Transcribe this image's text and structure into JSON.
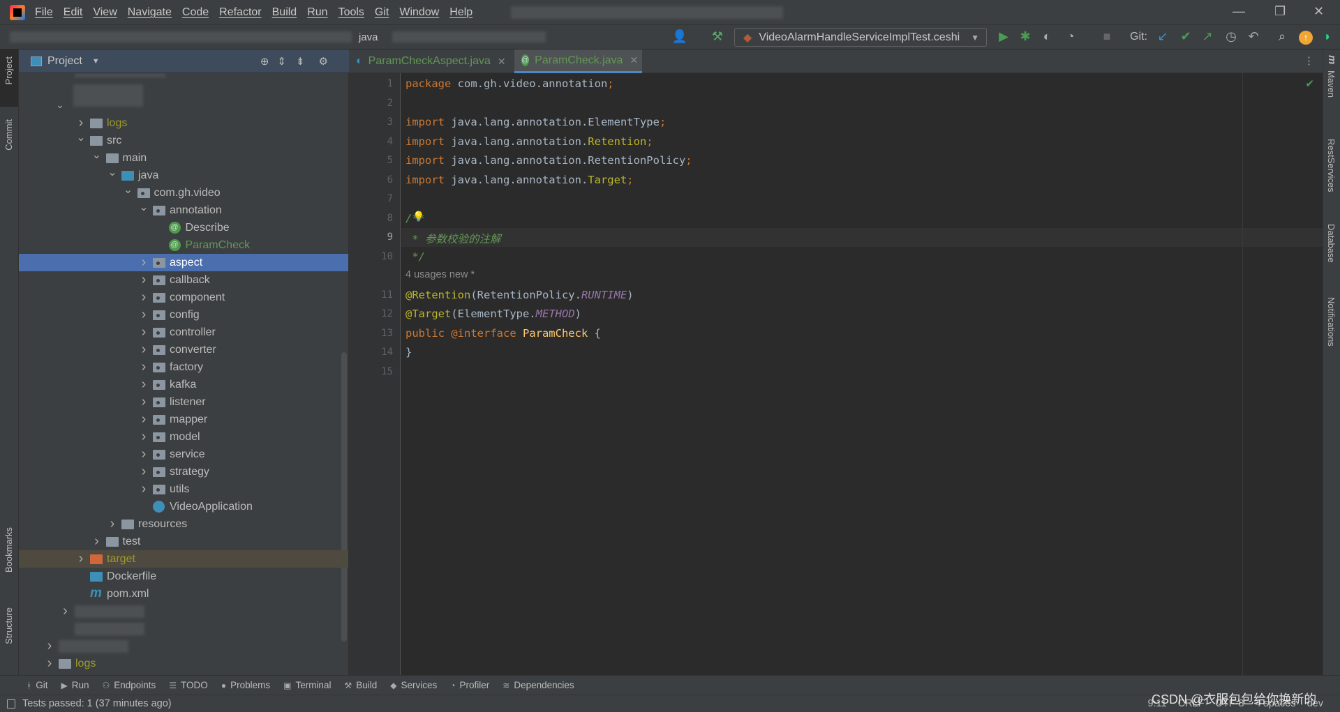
{
  "menu": [
    "File",
    "Edit",
    "View",
    "Navigate",
    "Code",
    "Refactor",
    "Build",
    "Run",
    "Tools",
    "Git",
    "Window",
    "Help"
  ],
  "nav": {
    "crumb_java": "java"
  },
  "toolbar": {
    "run_config": "VideoAlarmHandleServiceImplTest.ceshi",
    "git_label": "Git:"
  },
  "left_stripe": [
    "Project",
    "Commit",
    "Bookmarks",
    "Structure"
  ],
  "right_stripe": [
    "Maven",
    "RestServices",
    "Database",
    "Notifications"
  ],
  "project_panel": {
    "title": "Project"
  },
  "tree": [
    {
      "label": "logs",
      "level": 0,
      "chevron": ">",
      "icon": "folder",
      "color": "#9e9b2b"
    },
    {
      "label": "src",
      "level": 0,
      "chevron": "v",
      "icon": "folder"
    },
    {
      "label": "main",
      "level": 1,
      "chevron": "v",
      "icon": "folder"
    },
    {
      "label": "java",
      "level": 2,
      "chevron": "v",
      "icon": "folder-blue"
    },
    {
      "label": "com.gh.video",
      "level": 3,
      "chevron": "v",
      "icon": "package"
    },
    {
      "label": "annotation",
      "level": 4,
      "chevron": "v",
      "icon": "package"
    },
    {
      "label": "Describe",
      "level": 5,
      "chevron": "",
      "icon": "annotation"
    },
    {
      "label": "ParamCheck",
      "level": 5,
      "chevron": "",
      "icon": "annotation",
      "color": "#629755"
    },
    {
      "label": "aspect",
      "level": 4,
      "chevron": ">",
      "icon": "package",
      "selected": true
    },
    {
      "label": "callback",
      "level": 4,
      "chevron": ">",
      "icon": "package"
    },
    {
      "label": "component",
      "level": 4,
      "chevron": ">",
      "icon": "package"
    },
    {
      "label": "config",
      "level": 4,
      "chevron": ">",
      "icon": "package"
    },
    {
      "label": "controller",
      "level": 4,
      "chevron": ">",
      "icon": "package"
    },
    {
      "label": "converter",
      "level": 4,
      "chevron": ">",
      "icon": "package"
    },
    {
      "label": "factory",
      "level": 4,
      "chevron": ">",
      "icon": "package"
    },
    {
      "label": "kafka",
      "level": 4,
      "chevron": ">",
      "icon": "package"
    },
    {
      "label": "listener",
      "level": 4,
      "chevron": ">",
      "icon": "package"
    },
    {
      "label": "mapper",
      "level": 4,
      "chevron": ">",
      "icon": "package"
    },
    {
      "label": "model",
      "level": 4,
      "chevron": ">",
      "icon": "package"
    },
    {
      "label": "service",
      "level": 4,
      "chevron": ">",
      "icon": "package"
    },
    {
      "label": "strategy",
      "level": 4,
      "chevron": ">",
      "icon": "package"
    },
    {
      "label": "utils",
      "level": 4,
      "chevron": ">",
      "icon": "package"
    },
    {
      "label": "VideoApplication",
      "level": 4,
      "chevron": "",
      "icon": "spring-app"
    },
    {
      "label": "resources",
      "level": 2,
      "chevron": ">",
      "icon": "folder"
    },
    {
      "label": "test",
      "level": 1,
      "chevron": ">",
      "icon": "folder"
    },
    {
      "label": "target",
      "level": 0,
      "chevron": ">",
      "icon": "folder-orange",
      "color": "#9e9b2b",
      "highlight": true
    },
    {
      "label": "Dockerfile",
      "level": 0,
      "chevron": "",
      "icon": "docker"
    },
    {
      "label": "pom.xml",
      "level": 0,
      "chevron": "",
      "icon": "maven"
    },
    {
      "label": "",
      "level": -1,
      "chevron": ">",
      "icon": "blurred"
    },
    {
      "label": "",
      "level": -1,
      "chevron": "",
      "icon": "blurred"
    },
    {
      "label": "",
      "level": -2,
      "chevron": ">",
      "icon": "blurred"
    },
    {
      "label": "logs",
      "level": -2,
      "chevron": ">",
      "icon": "folder",
      "color": "#9e9b2b"
    }
  ],
  "tabs": [
    {
      "label": "ParamCheckAspect.java",
      "icon": "aspect-class-icon",
      "active": false
    },
    {
      "label": "ParamCheck.java",
      "icon": "annotation-icon",
      "active": true
    }
  ],
  "editor": {
    "current_line": 9,
    "inlay": "4 usages   new *",
    "lines": [
      [
        [
          "kw",
          "package "
        ],
        [
          "cls",
          "com.gh.video.annotation"
        ],
        [
          "semi",
          ";"
        ]
      ],
      [],
      [
        [
          "kw",
          "import "
        ],
        [
          "cls",
          "java.lang.annotation.ElementType"
        ],
        [
          "semi",
          ";"
        ]
      ],
      [
        [
          "kw",
          "import "
        ],
        [
          "cls",
          "java.lang.annotation."
        ],
        [
          "ann",
          "Retention"
        ],
        [
          "semi",
          ";"
        ]
      ],
      [
        [
          "kw",
          "import "
        ],
        [
          "cls",
          "java.lang.annotation.RetentionPolicy"
        ],
        [
          "semi",
          ";"
        ]
      ],
      [
        [
          "kw",
          "import "
        ],
        [
          "cls",
          "java.lang.annotation."
        ],
        [
          "ann",
          "Target"
        ],
        [
          "semi",
          ";"
        ]
      ],
      [],
      [
        [
          "cmt",
          "/**"
        ]
      ],
      [
        [
          "cmt",
          " * 参数校验的注解"
        ]
      ],
      [
        [
          "cmt",
          " */"
        ]
      ],
      [
        [
          "ann",
          "@Retention"
        ],
        [
          "cls",
          "(RetentionPolicy."
        ],
        [
          "const",
          "RUNTIME"
        ],
        [
          "cls",
          ")"
        ]
      ],
      [
        [
          "ann",
          "@Target"
        ],
        [
          "cls",
          "(ElementType."
        ],
        [
          "const",
          "METHOD"
        ],
        [
          "cls",
          ")"
        ]
      ],
      [
        [
          "kw",
          "public "
        ],
        [
          "kw",
          "@interface "
        ],
        [
          "yel",
          "ParamCheck "
        ],
        [
          "cls",
          "{"
        ]
      ],
      [
        [
          "cls",
          "}"
        ]
      ],
      []
    ]
  },
  "bottom_tools": [
    "Git",
    "Run",
    "Endpoints",
    "TODO",
    "Problems",
    "Terminal",
    "Build",
    "Services",
    "Profiler",
    "Dependencies"
  ],
  "status": {
    "message": "Tests passed: 1 (37 minutes ago)",
    "position": "9:11",
    "line_sep": "CRLF",
    "encoding": "UTF-8",
    "indent": "4 spaces",
    "branch": "dev",
    "watermark": "CSDN @衣服包包给你换新的"
  }
}
